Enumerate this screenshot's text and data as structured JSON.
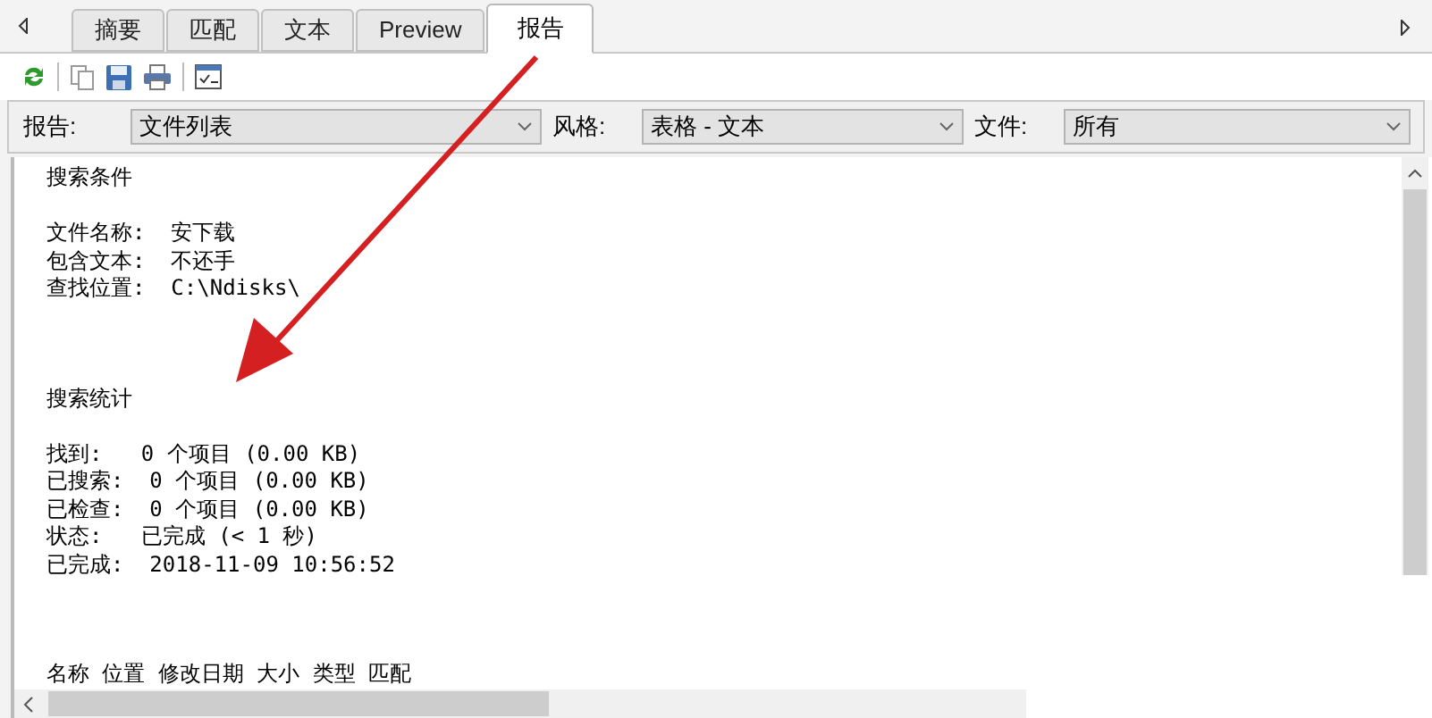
{
  "tabs": [
    {
      "label": "摘要",
      "selected": false
    },
    {
      "label": "匹配",
      "selected": false
    },
    {
      "label": "文本",
      "selected": false
    },
    {
      "label": "Preview",
      "selected": false
    },
    {
      "label": "报告",
      "selected": true
    }
  ],
  "filters": [
    {
      "label": "报告:",
      "value": "文件列表"
    },
    {
      "label": "风格:",
      "value": "表格 - 文本"
    },
    {
      "label": "文件:",
      "value": "所有"
    }
  ],
  "report": [
    {
      "title": "搜索条件",
      "lines": [
        "文件名称:  安下载",
        "包含文本:  不还手",
        "查找位置:  C:\\Ndisks\\"
      ]
    },
    {
      "title": "搜索统计",
      "lines": [
        "找到:   0 个项目 (0.00 KB)",
        "已搜索:  0 个项目 (0.00 KB)",
        "已检查:  0 个项目 (0.00 KB)",
        "状态:   已完成 (< 1 秒)",
        "已完成:  2018-11-09 10:56:52"
      ]
    },
    {
      "title": "名称 位置 修改日期 大小 类型 匹配"
    }
  ]
}
